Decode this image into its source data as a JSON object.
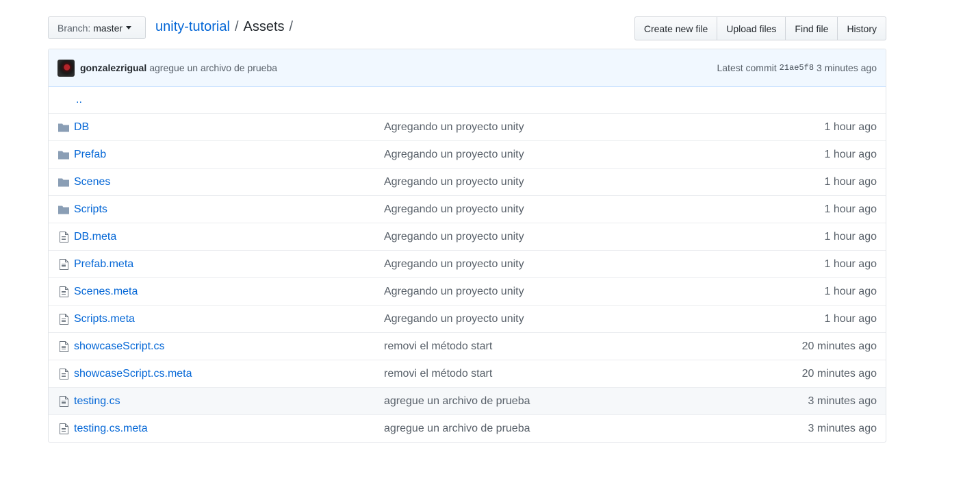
{
  "header": {
    "branch_prefix": "Branch:",
    "branch_name": "master",
    "repo_name": "unity-tutorial",
    "separator": "/",
    "current_dir": "Assets",
    "trailing_separator": "/"
  },
  "actions": {
    "create_new_file": "Create new file",
    "upload_files": "Upload files",
    "find_file": "Find file",
    "history": "History"
  },
  "commit": {
    "author": "gonzalezrigual",
    "message": "agregue un archivo de prueba",
    "latest_label": "Latest commit",
    "sha": "21ae5f8",
    "age": "3 minutes ago"
  },
  "up_dir": "..",
  "files": [
    {
      "name": "DB",
      "type": "folder",
      "message": "Agregando un proyecto unity",
      "age": "1 hour ago"
    },
    {
      "name": "Prefab",
      "type": "folder",
      "message": "Agregando un proyecto unity",
      "age": "1 hour ago"
    },
    {
      "name": "Scenes",
      "type": "folder",
      "message": "Agregando un proyecto unity",
      "age": "1 hour ago"
    },
    {
      "name": "Scripts",
      "type": "folder",
      "message": "Agregando un proyecto unity",
      "age": "1 hour ago"
    },
    {
      "name": "DB.meta",
      "type": "file",
      "message": "Agregando un proyecto unity",
      "age": "1 hour ago"
    },
    {
      "name": "Prefab.meta",
      "type": "file",
      "message": "Agregando un proyecto unity",
      "age": "1 hour ago"
    },
    {
      "name": "Scenes.meta",
      "type": "file",
      "message": "Agregando un proyecto unity",
      "age": "1 hour ago"
    },
    {
      "name": "Scripts.meta",
      "type": "file",
      "message": "Agregando un proyecto unity",
      "age": "1 hour ago"
    },
    {
      "name": "showcaseScript.cs",
      "type": "file",
      "message": "removi el método start",
      "age": "20 minutes ago"
    },
    {
      "name": "showcaseScript.cs.meta",
      "type": "file",
      "message": "removi el método start",
      "age": "20 minutes ago"
    },
    {
      "name": "testing.cs",
      "type": "file",
      "message": "agregue un archivo de prueba",
      "age": "3 minutes ago",
      "highlighted": true
    },
    {
      "name": "testing.cs.meta",
      "type": "file",
      "message": "agregue un archivo de prueba",
      "age": "3 minutes ago"
    }
  ],
  "colors": {
    "link": "#0366d6",
    "muted": "#586069",
    "commit_bg": "#f1f8ff",
    "folder_icon": "#79b8ff",
    "file_icon": "#6a737d"
  },
  "icons": {
    "folder": "folder-icon",
    "file": "file-icon",
    "caret": "caret-down-icon"
  }
}
